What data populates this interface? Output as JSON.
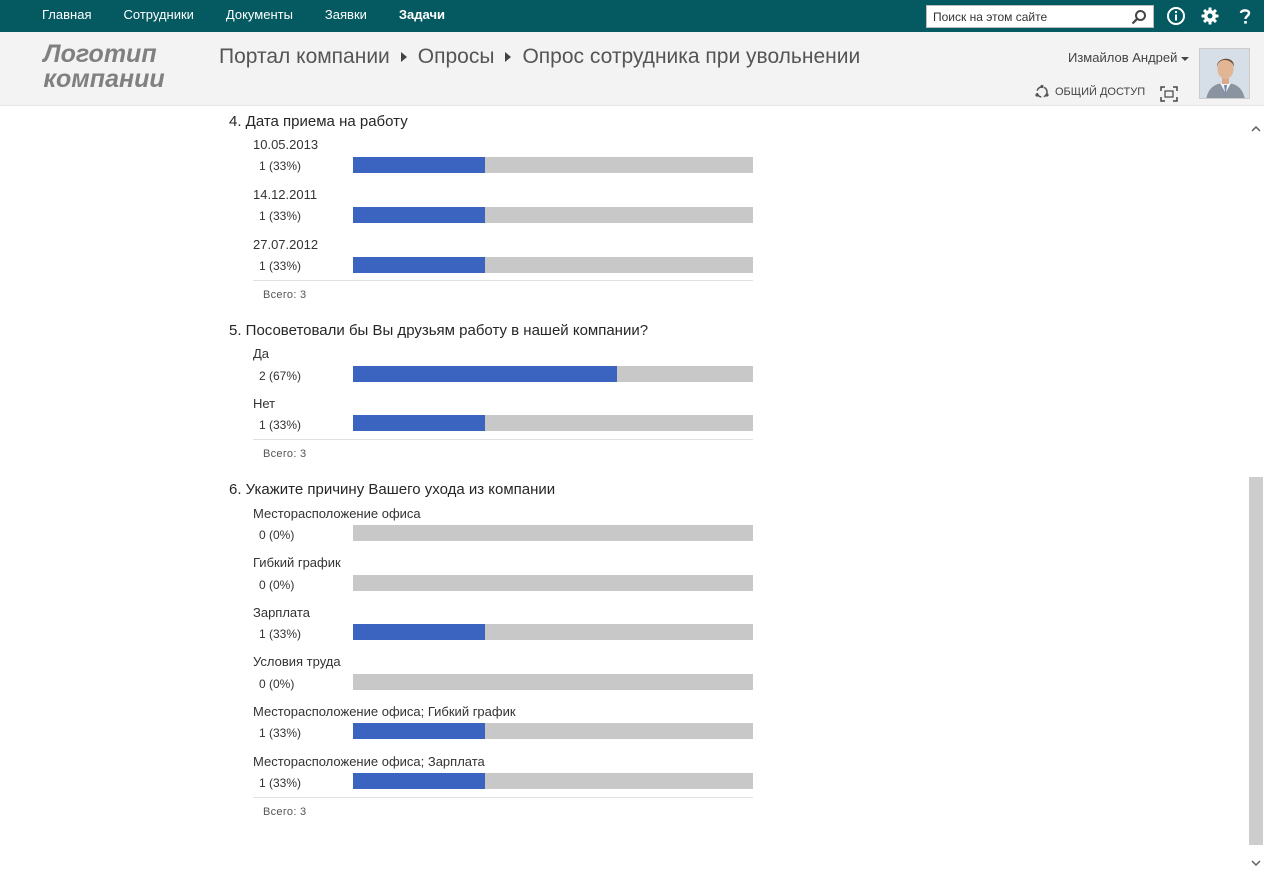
{
  "suitebar": {
    "nav": [
      "Главная",
      "Сотрудники",
      "Документы",
      "Заявки",
      "Задачи"
    ],
    "active_index": 4,
    "search_placeholder": "Поиск на этом сайте"
  },
  "header": {
    "logo_line1": "Логотип",
    "logo_line2": "компании",
    "breadcrumb": [
      "Портал компании",
      "Опросы",
      "Опрос сотрудника при увольнении"
    ],
    "user_name": "Измайлов Андрей",
    "share_label": "ОБЩИЙ ДОСТУП"
  },
  "colors": {
    "suitebar": "#055a61",
    "bar_fill": "#3b64c1",
    "bar_track": "#c8c8c8"
  },
  "questions": [
    {
      "title": "4. Дата приема на работу",
      "answers": [
        {
          "label": "10.05.2013",
          "count": "1 (33%)",
          "fraction": 0.33
        },
        {
          "label": "14.12.2011",
          "count": "1 (33%)",
          "fraction": 0.33
        },
        {
          "label": "27.07.2012",
          "count": "1 (33%)",
          "fraction": 0.33
        }
      ],
      "total": "Всего: 3"
    },
    {
      "title": "5. Посоветовали бы Вы друзьям работу в нашей компании?",
      "answers": [
        {
          "label": "Да",
          "count": "2 (67%)",
          "fraction": 0.66
        },
        {
          "label": "Нет",
          "count": "1 (33%)",
          "fraction": 0.33
        }
      ],
      "total": "Всего: 3"
    },
    {
      "title": "6. Укажите причину Вашего ухода из компании",
      "answers": [
        {
          "label": "Месторасположение офиса",
          "count": "0 (0%)",
          "fraction": 0
        },
        {
          "label": "Гибкий график",
          "count": "0 (0%)",
          "fraction": 0
        },
        {
          "label": "Зарплата",
          "count": "1 (33%)",
          "fraction": 0.33
        },
        {
          "label": "Условия труда",
          "count": "0 (0%)",
          "fraction": 0
        },
        {
          "label": "Месторасположение офиса; Гибкий график",
          "count": "1 (33%)",
          "fraction": 0.33
        },
        {
          "label": "Месторасположение офиса; Зарплата",
          "count": "1 (33%)",
          "fraction": 0.33
        }
      ],
      "total": "Всего: 3"
    }
  ]
}
